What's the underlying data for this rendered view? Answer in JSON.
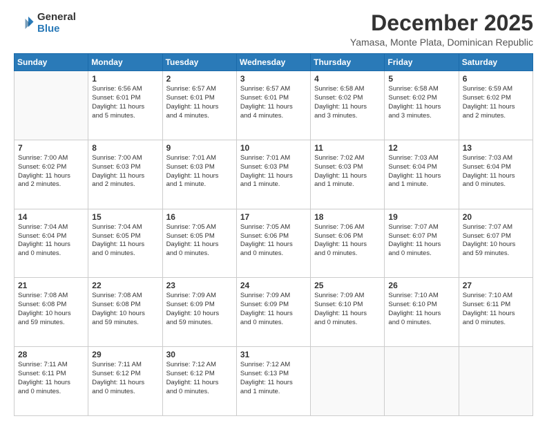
{
  "header": {
    "logo_line1": "General",
    "logo_line2": "Blue",
    "month": "December 2025",
    "location": "Yamasa, Monte Plata, Dominican Republic"
  },
  "weekdays": [
    "Sunday",
    "Monday",
    "Tuesday",
    "Wednesday",
    "Thursday",
    "Friday",
    "Saturday"
  ],
  "weeks": [
    [
      {
        "day": "",
        "info": ""
      },
      {
        "day": "1",
        "info": "Sunrise: 6:56 AM\nSunset: 6:01 PM\nDaylight: 11 hours\nand 5 minutes."
      },
      {
        "day": "2",
        "info": "Sunrise: 6:57 AM\nSunset: 6:01 PM\nDaylight: 11 hours\nand 4 minutes."
      },
      {
        "day": "3",
        "info": "Sunrise: 6:57 AM\nSunset: 6:01 PM\nDaylight: 11 hours\nand 4 minutes."
      },
      {
        "day": "4",
        "info": "Sunrise: 6:58 AM\nSunset: 6:02 PM\nDaylight: 11 hours\nand 3 minutes."
      },
      {
        "day": "5",
        "info": "Sunrise: 6:58 AM\nSunset: 6:02 PM\nDaylight: 11 hours\nand 3 minutes."
      },
      {
        "day": "6",
        "info": "Sunrise: 6:59 AM\nSunset: 6:02 PM\nDaylight: 11 hours\nand 2 minutes."
      }
    ],
    [
      {
        "day": "7",
        "info": "Sunrise: 7:00 AM\nSunset: 6:02 PM\nDaylight: 11 hours\nand 2 minutes."
      },
      {
        "day": "8",
        "info": "Sunrise: 7:00 AM\nSunset: 6:03 PM\nDaylight: 11 hours\nand 2 minutes."
      },
      {
        "day": "9",
        "info": "Sunrise: 7:01 AM\nSunset: 6:03 PM\nDaylight: 11 hours\nand 1 minute."
      },
      {
        "day": "10",
        "info": "Sunrise: 7:01 AM\nSunset: 6:03 PM\nDaylight: 11 hours\nand 1 minute."
      },
      {
        "day": "11",
        "info": "Sunrise: 7:02 AM\nSunset: 6:03 PM\nDaylight: 11 hours\nand 1 minute."
      },
      {
        "day": "12",
        "info": "Sunrise: 7:03 AM\nSunset: 6:04 PM\nDaylight: 11 hours\nand 1 minute."
      },
      {
        "day": "13",
        "info": "Sunrise: 7:03 AM\nSunset: 6:04 PM\nDaylight: 11 hours\nand 0 minutes."
      }
    ],
    [
      {
        "day": "14",
        "info": "Sunrise: 7:04 AM\nSunset: 6:04 PM\nDaylight: 11 hours\nand 0 minutes."
      },
      {
        "day": "15",
        "info": "Sunrise: 7:04 AM\nSunset: 6:05 PM\nDaylight: 11 hours\nand 0 minutes."
      },
      {
        "day": "16",
        "info": "Sunrise: 7:05 AM\nSunset: 6:05 PM\nDaylight: 11 hours\nand 0 minutes."
      },
      {
        "day": "17",
        "info": "Sunrise: 7:05 AM\nSunset: 6:06 PM\nDaylight: 11 hours\nand 0 minutes."
      },
      {
        "day": "18",
        "info": "Sunrise: 7:06 AM\nSunset: 6:06 PM\nDaylight: 11 hours\nand 0 minutes."
      },
      {
        "day": "19",
        "info": "Sunrise: 7:07 AM\nSunset: 6:07 PM\nDaylight: 11 hours\nand 0 minutes."
      },
      {
        "day": "20",
        "info": "Sunrise: 7:07 AM\nSunset: 6:07 PM\nDaylight: 10 hours\nand 59 minutes."
      }
    ],
    [
      {
        "day": "21",
        "info": "Sunrise: 7:08 AM\nSunset: 6:08 PM\nDaylight: 10 hours\nand 59 minutes."
      },
      {
        "day": "22",
        "info": "Sunrise: 7:08 AM\nSunset: 6:08 PM\nDaylight: 10 hours\nand 59 minutes."
      },
      {
        "day": "23",
        "info": "Sunrise: 7:09 AM\nSunset: 6:09 PM\nDaylight: 10 hours\nand 59 minutes."
      },
      {
        "day": "24",
        "info": "Sunrise: 7:09 AM\nSunset: 6:09 PM\nDaylight: 11 hours\nand 0 minutes."
      },
      {
        "day": "25",
        "info": "Sunrise: 7:09 AM\nSunset: 6:10 PM\nDaylight: 11 hours\nand 0 minutes."
      },
      {
        "day": "26",
        "info": "Sunrise: 7:10 AM\nSunset: 6:10 PM\nDaylight: 11 hours\nand 0 minutes."
      },
      {
        "day": "27",
        "info": "Sunrise: 7:10 AM\nSunset: 6:11 PM\nDaylight: 11 hours\nand 0 minutes."
      }
    ],
    [
      {
        "day": "28",
        "info": "Sunrise: 7:11 AM\nSunset: 6:11 PM\nDaylight: 11 hours\nand 0 minutes."
      },
      {
        "day": "29",
        "info": "Sunrise: 7:11 AM\nSunset: 6:12 PM\nDaylight: 11 hours\nand 0 minutes."
      },
      {
        "day": "30",
        "info": "Sunrise: 7:12 AM\nSunset: 6:12 PM\nDaylight: 11 hours\nand 0 minutes."
      },
      {
        "day": "31",
        "info": "Sunrise: 7:12 AM\nSunset: 6:13 PM\nDaylight: 11 hours\nand 1 minute."
      },
      {
        "day": "",
        "info": ""
      },
      {
        "day": "",
        "info": ""
      },
      {
        "day": "",
        "info": ""
      }
    ]
  ]
}
